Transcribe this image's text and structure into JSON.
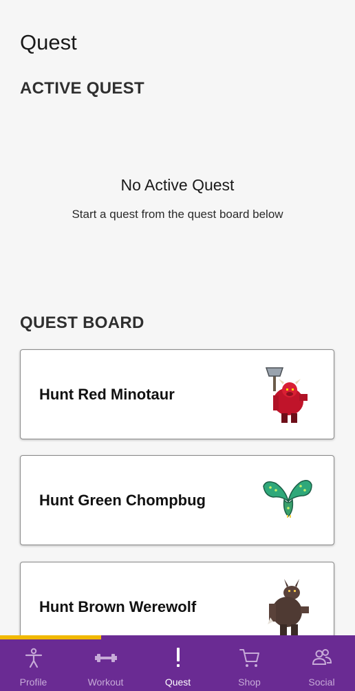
{
  "header": {
    "title": "Quest"
  },
  "active_quest": {
    "heading": "ACTIVE QUEST",
    "empty_title": "No Active Quest",
    "empty_subtitle": "Start a quest from the quest board below"
  },
  "quest_board": {
    "heading": "QUEST BOARD",
    "quests": [
      {
        "label": "Hunt Red Minotaur",
        "icon": "red-minotaur-icon"
      },
      {
        "label": "Hunt Green Chompbug",
        "icon": "green-chompbug-icon"
      },
      {
        "label": "Hunt Brown Werewolf",
        "icon": "brown-werewolf-icon"
      }
    ]
  },
  "bottom_nav": {
    "items": [
      {
        "label": "Profile",
        "icon": "person-icon"
      },
      {
        "label": "Workout",
        "icon": "dumbbell-icon"
      },
      {
        "label": "Quest",
        "icon": "exclamation-icon",
        "active": true
      },
      {
        "label": "Shop",
        "icon": "cart-icon"
      },
      {
        "label": "Social",
        "icon": "people-icon"
      }
    ],
    "accent_color": "#f1b800",
    "background_color": "#6a2b93"
  }
}
